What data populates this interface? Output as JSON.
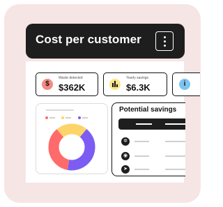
{
  "header": {
    "title": "Cost per customer",
    "menu_icon": "kebab-menu-icon"
  },
  "stats": [
    {
      "label": "Waste detected",
      "value": "$362K",
      "icon": "dollar-icon",
      "icon_glyph": "$",
      "color": "#f28b82"
    },
    {
      "label": "Yearly savings",
      "value": "$6.3K",
      "icon": "bar-chart-icon",
      "icon_glyph": "▮",
      "color": "#fde68a"
    },
    {
      "label": "",
      "value": "",
      "icon": "info-icon",
      "icon_glyph": "i",
      "color": "#7cc4f0"
    }
  ],
  "donut": {
    "legend_colors": [
      "#ff6b6b",
      "#fcd46a",
      "#7c5cf2"
    ],
    "segments": [
      {
        "color": "#fcd46a",
        "fraction": 0.22
      },
      {
        "color": "#7c5cf2",
        "fraction": 0.42
      },
      {
        "color": "#ff6b6b",
        "fraction": 0.36
      }
    ]
  },
  "savings": {
    "title": "Potential savings",
    "rows": [
      {
        "icon": "gear-icon",
        "glyph": "✲"
      },
      {
        "icon": "settings-icon",
        "glyph": "◉"
      },
      {
        "icon": "rocket-icon",
        "glyph": "➤"
      }
    ]
  }
}
